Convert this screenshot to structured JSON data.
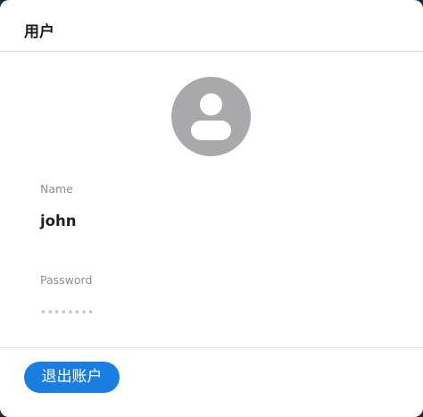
{
  "dialog": {
    "title": "用户"
  },
  "avatar": {
    "icon": "user-icon"
  },
  "fields": {
    "name_label": "Name",
    "name_value": "john",
    "password_label": "Password",
    "password_value": "••••••••"
  },
  "footer": {
    "logout_label": "退出账户"
  },
  "colors": {
    "accent": "#1a7de2",
    "avatar_bg": "#a9a9ab",
    "label": "#8d8d8d"
  }
}
